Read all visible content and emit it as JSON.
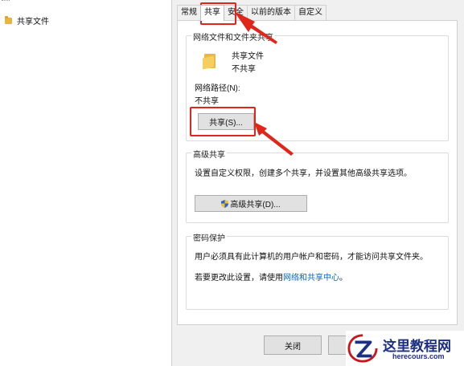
{
  "explorer": {
    "folder_label": "共享文件"
  },
  "tabs": [
    "常规",
    "共享",
    "安全",
    "以前的版本",
    "自定义"
  ],
  "network_share": {
    "group_title": "网络文件和文件夹共享",
    "item_name": "共享文件",
    "item_status": "不共享",
    "path_label": "网络路径(N):",
    "path_value": "不共享",
    "share_button": "共享(S)..."
  },
  "advanced_share": {
    "group_title": "高级共享",
    "description": "设置自定义权限，创建多个共享，并设置其他高级共享选项。",
    "button": "高级共享(D)..."
  },
  "password_protect": {
    "group_title": "密码保护",
    "description": "用户必须具有此计算机的用户帐户和密码，才能访问共享文件夹。",
    "change_text": "若要更改此设置，请使用",
    "link_text": "网络和共享中心",
    "period": "。"
  },
  "footer": {
    "close_button": "关闭"
  },
  "watermark": {
    "title": "这里教程网",
    "url": "herecours.com"
  },
  "colors": {
    "annotation_red": "#e0261b",
    "link_blue": "#0066cc",
    "watermark_blue": "#1d2f82"
  }
}
